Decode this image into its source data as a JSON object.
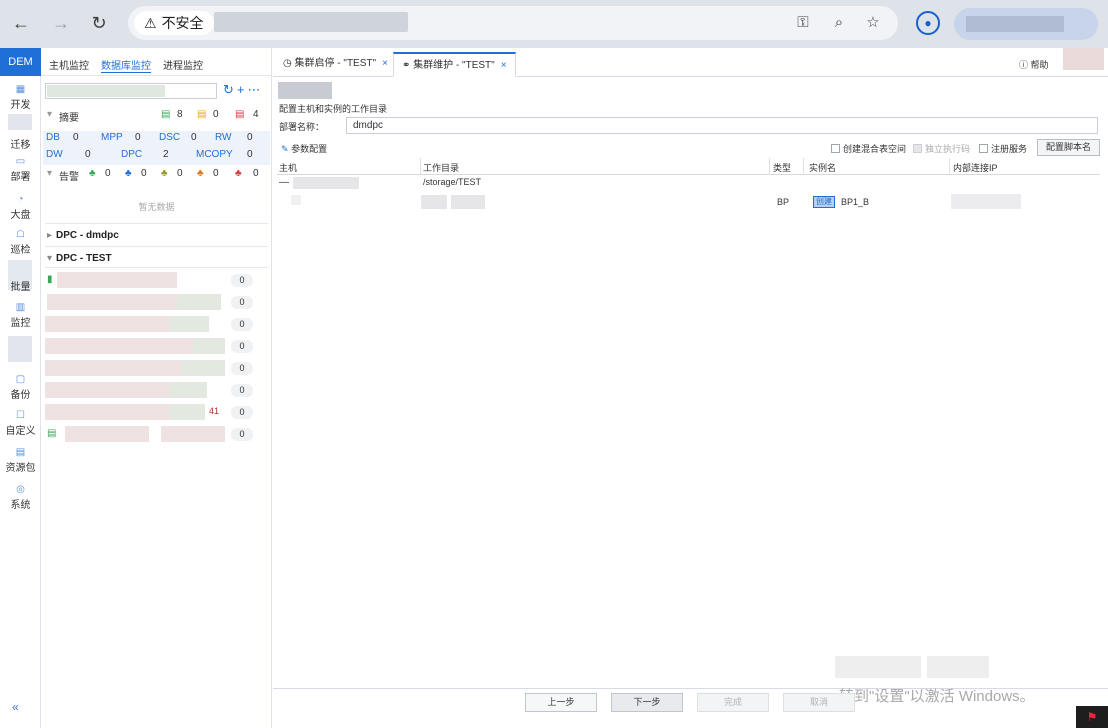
{
  "browser": {
    "security_label": "不安全",
    "back_icon": "←",
    "forward_icon": "→",
    "reload_icon": "↻"
  },
  "sidebar": {
    "brand": "DEM",
    "items": [
      {
        "label": "开发",
        "icon": "grid-icon"
      },
      {
        "label": "迁移",
        "icon": "migrate-icon"
      },
      {
        "label": "部署",
        "icon": "deploy-icon"
      },
      {
        "label": "大盘",
        "icon": "gauge-icon"
      },
      {
        "label": "巡检",
        "icon": "inspect-icon"
      },
      {
        "label": "批量",
        "icon": "batch-icon"
      },
      {
        "label": "监控",
        "icon": "monitor-icon"
      },
      {
        "label": "备份",
        "icon": "backup-icon"
      },
      {
        "label": "自定义",
        "icon": "custom-icon"
      },
      {
        "label": "资源包",
        "icon": "package-icon"
      },
      {
        "label": "系统",
        "icon": "system-icon"
      }
    ],
    "collapse": "«"
  },
  "left_panel": {
    "tabs": [
      "主机监控",
      "数据库监控",
      "进程监控"
    ],
    "summary": {
      "label": "摘要",
      "green": "8",
      "orange": "0",
      "red": "4"
    },
    "grid": [
      {
        "k": "DB",
        "v": "0"
      },
      {
        "k": "MPP",
        "v": "0"
      },
      {
        "k": "DSC",
        "v": "0"
      },
      {
        "k": "RW",
        "v": "0"
      },
      {
        "k": "DW",
        "v": "0"
      },
      {
        "k": "DPC",
        "v": "2"
      },
      {
        "k": "MCOPY",
        "v": "0"
      }
    ],
    "alarm": {
      "label": "告警",
      "counts": [
        "0",
        "0",
        "0",
        "0",
        "0"
      ]
    },
    "no_data": "暂无数据",
    "groups": [
      "DPC - dmdpc",
      "DPC - TEST"
    ],
    "instance_counts": [
      "0",
      "0",
      "0",
      "0",
      "0",
      "0",
      "0",
      "0"
    ],
    "special_value": "41"
  },
  "right_panel": {
    "tabs": [
      {
        "label": "集群启停 - \"TEST\"",
        "close": "×"
      },
      {
        "label": "集群维护 - \"TEST\"",
        "close": "×"
      }
    ],
    "help": "帮助",
    "config_title": "配置主机和实例的工作目录",
    "deploy_name_label": "部署名称：",
    "deploy_name_value": "dmdpc",
    "param_config": "参数配置",
    "checkboxes": [
      "创建混合表空间",
      "独立执行码",
      "注册服务"
    ],
    "config_script_btn": "配置脚本名",
    "columns": [
      "主机",
      "工作目录",
      "类型",
      "实例名",
      "内部连接IP"
    ],
    "rows": [
      {
        "dash": "—",
        "dir": "/storage/TEST"
      },
      {
        "type": "BP",
        "tag": "创建",
        "instance": "BP1_B"
      }
    ],
    "footer_buttons": [
      "上一步",
      "下一步",
      "完成",
      "取消"
    ],
    "watermark": "转到\"设置\"以激活 Windows。"
  }
}
